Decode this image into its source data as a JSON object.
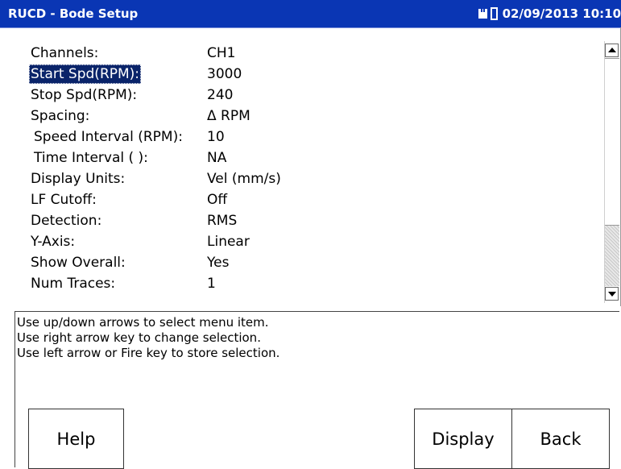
{
  "titlebar": {
    "title": "RUCD - Bode Setup",
    "datetime": "02/09/2013 10:10",
    "icons": [
      "memory-card-icon",
      "battery-icon"
    ]
  },
  "menu": {
    "items": [
      {
        "label": "Channels:",
        "value": "CH1",
        "selected": false,
        "indent": false
      },
      {
        "label": "Start Spd(RPM):",
        "value": "3000",
        "selected": true,
        "indent": false
      },
      {
        "label": "Stop Spd(RPM):",
        "value": "240",
        "selected": false,
        "indent": false
      },
      {
        "label": "Spacing:",
        "value": "Δ RPM",
        "selected": false,
        "indent": false
      },
      {
        "label": "Speed Interval (RPM):",
        "value": "10",
        "selected": false,
        "indent": true
      },
      {
        "label": "Time Interval ( ):",
        "value": "NA",
        "selected": false,
        "indent": true
      },
      {
        "label": "Display Units:",
        "value": "Vel (mm/s)",
        "selected": false,
        "indent": false
      },
      {
        "label": "LF Cutoff:",
        "value": "Off",
        "selected": false,
        "indent": false
      },
      {
        "label": "Detection:",
        "value": "RMS",
        "selected": false,
        "indent": false
      },
      {
        "label": "Y-Axis:",
        "value": "Linear",
        "selected": false,
        "indent": false
      },
      {
        "label": "Show Overall:",
        "value": "Yes",
        "selected": false,
        "indent": false
      },
      {
        "label": "Num Traces:",
        "value": "1",
        "selected": false,
        "indent": false
      }
    ]
  },
  "help": {
    "lines": [
      "Use up/down arrows to select menu item.",
      "Use right arrow key to change selection.",
      "Use left arrow or Fire key to store selection."
    ]
  },
  "buttons": {
    "help": "Help",
    "display": "Display",
    "back": "Back"
  },
  "colors": {
    "titlebar": "#0a36b4",
    "selection": "#0a246a"
  }
}
